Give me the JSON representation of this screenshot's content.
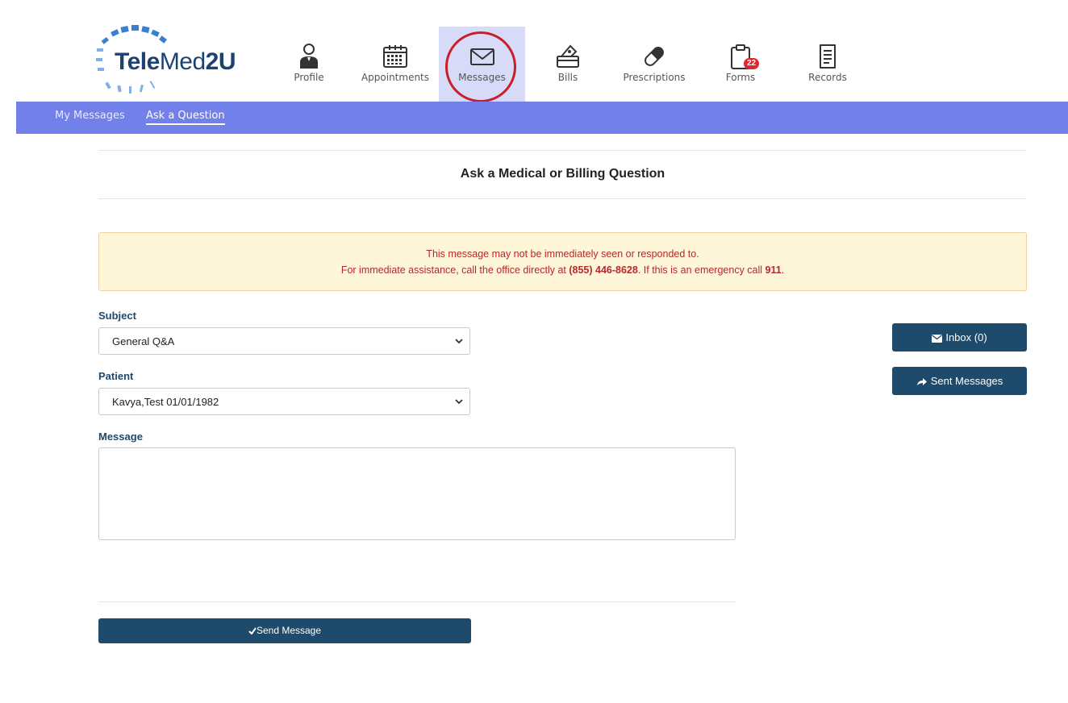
{
  "logo": {
    "part1": "Tele",
    "part2": "Med",
    "part3": "2U"
  },
  "nav": {
    "items": [
      {
        "label": "Profile",
        "icon": "person-icon"
      },
      {
        "label": "Appointments",
        "icon": "calendar-icon"
      },
      {
        "label": "Messages",
        "icon": "envelope-icon"
      },
      {
        "label": "Bills",
        "icon": "bills-icon"
      },
      {
        "label": "Prescriptions",
        "icon": "pill-icon"
      },
      {
        "label": "Forms",
        "icon": "clipboard-icon",
        "badge": "22"
      },
      {
        "label": "Records",
        "icon": "document-icon"
      }
    ],
    "active": "Messages"
  },
  "subnav": {
    "my_messages": "My Messages",
    "ask_question": "Ask a Question"
  },
  "page": {
    "title": "Ask a Medical or Billing Question"
  },
  "alert": {
    "line1": "This message may not be immediately seen or responded to.",
    "line2_prefix": "For immediate assistance, call the office directly at ",
    "phone": "(855) 446-8628",
    "line2_middle": ". If this is an emergency call ",
    "emergency": "911",
    "line2_suffix": "."
  },
  "form": {
    "subject_label": "Subject",
    "subject_value": "General Q&A",
    "patient_label": "Patient",
    "patient_value": "Kavya,Test 01/01/1982",
    "message_label": "Message",
    "message_value": ""
  },
  "buttons": {
    "inbox": "Inbox (0)",
    "sent": "Sent Messages",
    "send": "Send Message"
  },
  "colors": {
    "brand_dark": "#1e4a6c",
    "subnav": "#7280ea",
    "active_tab": "#d8dbf7",
    "highlight_ring": "#c8202a",
    "alert_text": "#b8282b",
    "alert_bg": "#fdf6d9"
  }
}
